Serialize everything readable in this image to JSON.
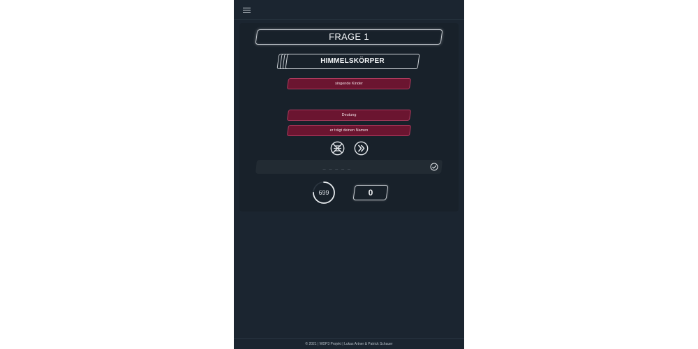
{
  "header": {
    "menu_icon": "hamburger-menu-icon"
  },
  "question": {
    "label": "FRAGE 1"
  },
  "category": {
    "label": "HIMMELSKÖRPER"
  },
  "hints": [
    {
      "label": "singende Kinder"
    },
    {
      "label": "Deutung"
    },
    {
      "label": "er trägt deinen Namen"
    }
  ],
  "controls": {
    "skip_icon": "skip-icon",
    "next_icon": "double-chevron-right-icon"
  },
  "answer": {
    "value": "_ _ _ _ _",
    "submit_icon": "check-circle-icon"
  },
  "timer": {
    "value": "699",
    "progress": 0.75
  },
  "score": {
    "value": "0"
  },
  "footer": {
    "text": "© 2021 | WDP3 Projekt | Lukas Artner & Patrick Schauer"
  },
  "colors": {
    "background": "#1b2530",
    "card": "#18212a",
    "hint": "#6b1530",
    "hint_border": "#b03a5e",
    "outline": "#c9ced3"
  }
}
